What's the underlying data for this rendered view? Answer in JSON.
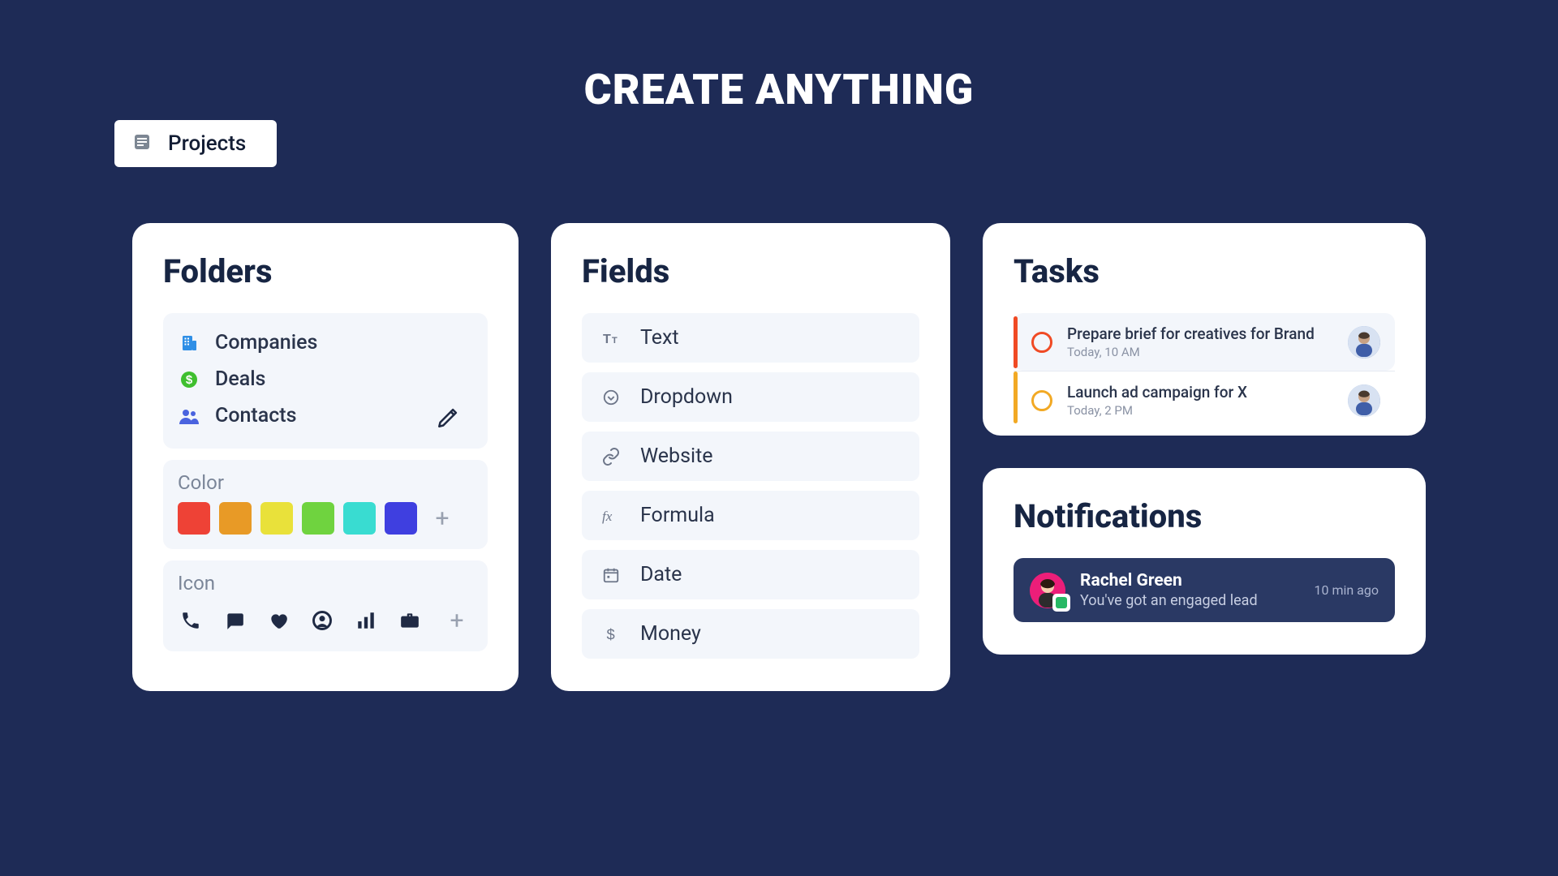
{
  "page_title": "CREATE ANYTHING",
  "projects_chip": {
    "label": "Projects"
  },
  "folders": {
    "title": "Folders",
    "items": [
      {
        "label": "Companies",
        "icon": "building-icon",
        "color": "#2f8fe6"
      },
      {
        "label": "Deals",
        "icon": "dollar-circle-icon",
        "color": "#3fbf2f"
      },
      {
        "label": "Contacts",
        "icon": "users-icon",
        "color": "#4a63df"
      }
    ],
    "color_label": "Color",
    "colors": [
      "#ee4236",
      "#e89a26",
      "#e9e13a",
      "#6fd33f",
      "#39dcd1",
      "#3f3fe0"
    ],
    "icon_label": "Icon"
  },
  "fields": {
    "title": "Fields",
    "items": [
      {
        "label": "Text",
        "icon": "text-icon"
      },
      {
        "label": "Dropdown",
        "icon": "dropdown-icon"
      },
      {
        "label": "Website",
        "icon": "link-icon"
      },
      {
        "label": "Formula",
        "icon": "formula-icon"
      },
      {
        "label": "Date",
        "icon": "calendar-icon"
      },
      {
        "label": "Money",
        "icon": "dollar-icon"
      }
    ]
  },
  "tasks": {
    "title": "Tasks",
    "items": [
      {
        "title": "Prepare brief for creatives for Brand",
        "time": "Today, 10 AM",
        "color": "#f04a24"
      },
      {
        "title": "Launch ad campaign for X",
        "time": "Today, 2 PM",
        "color": "#f2a924"
      }
    ]
  },
  "notifications": {
    "title": "Notifications",
    "item": {
      "name": "Rachel Green",
      "message": "You've got an engaged lead",
      "time": "10 min ago"
    }
  }
}
